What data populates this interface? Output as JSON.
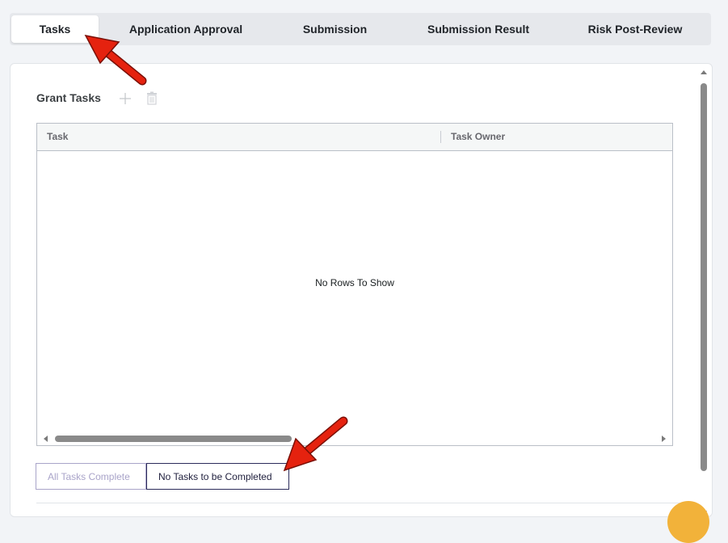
{
  "tabs": [
    {
      "label": "Tasks",
      "active": true
    },
    {
      "label": "Application Approval",
      "active": false
    },
    {
      "label": "Submission",
      "active": false
    },
    {
      "label": "Submission Result",
      "active": false
    },
    {
      "label": "Risk Post-Review",
      "active": false
    }
  ],
  "section": {
    "title": "Grant Tasks",
    "icons": [
      "plus-icon",
      "trash-icon"
    ]
  },
  "grid": {
    "columns": [
      "Task",
      "Task Owner"
    ],
    "rows": [],
    "empty_message": "No Rows To Show"
  },
  "buttons": {
    "all_complete": "All Tasks Complete",
    "none_to_complete": "No Tasks to be Completed"
  },
  "colors": {
    "annotation_arrow": "#e5220f",
    "button_disabled": "#a9a4c9",
    "button_outline": "#2b2b5a",
    "help_bubble": "#f2b23a"
  }
}
